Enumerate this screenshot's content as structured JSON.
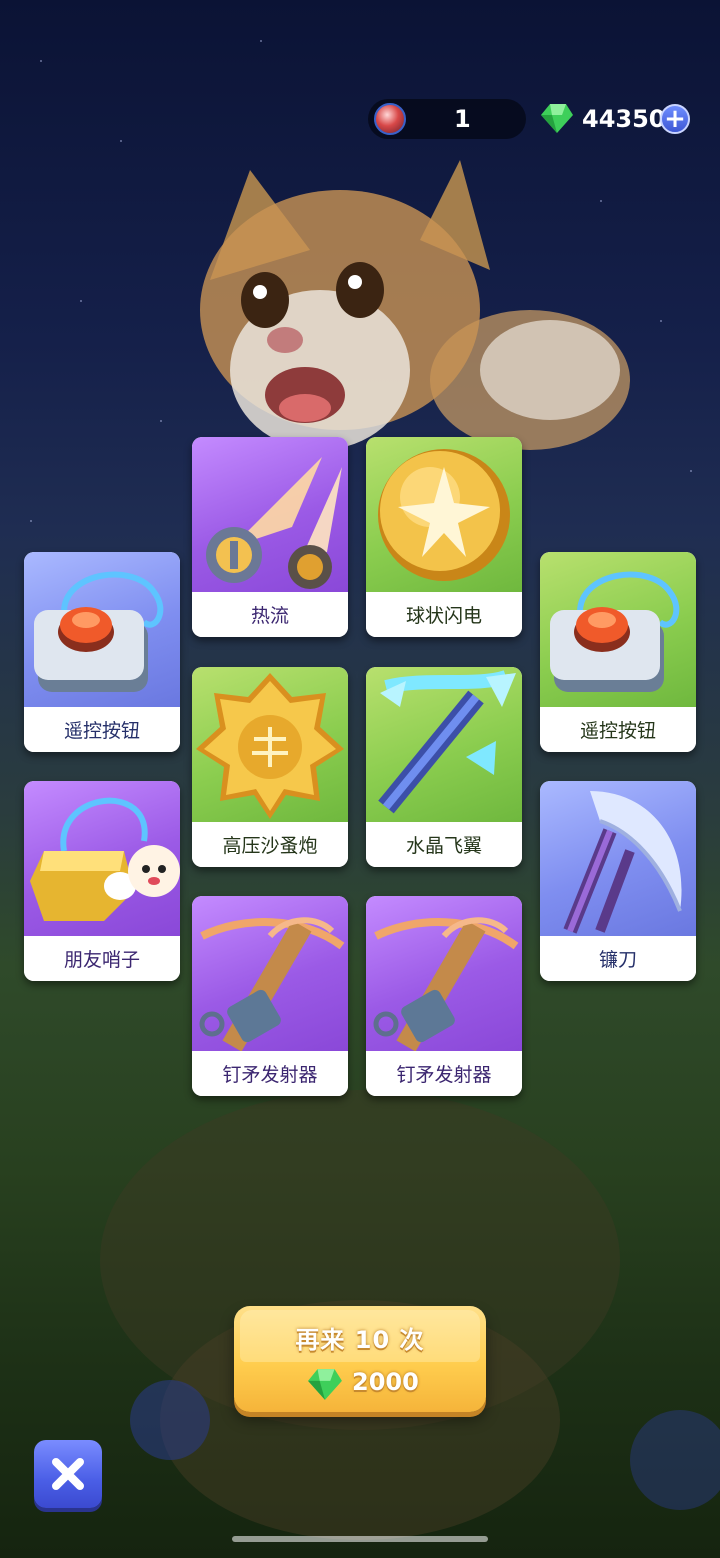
{
  "currency": {
    "tickets": "1",
    "gems": "44350",
    "ticket_icon": "ball-ticket-icon",
    "gem_icon": "green-gem-icon",
    "plus_icon": "plus-icon"
  },
  "character": {
    "name_icon": "corgi-dog-character"
  },
  "cards": [
    {
      "id": "remote-button-left",
      "label": "遥控按钮",
      "rarity": "blue",
      "icon": "remote-button-icon"
    },
    {
      "id": "friend-whistle",
      "label": "朋友哨子",
      "rarity": "purple",
      "icon": "whistle-icon"
    },
    {
      "id": "heat-flow",
      "label": "热流",
      "rarity": "purple",
      "icon": "heat-flow-icon"
    },
    {
      "id": "sandworm-cannon",
      "label": "高压沙蚤炮",
      "rarity": "green",
      "icon": "golden-badge-icon"
    },
    {
      "id": "harpoon-launcher-1",
      "label": "钉矛发射器",
      "rarity": "purple",
      "icon": "crossbow-icon"
    },
    {
      "id": "ball-lightning",
      "label": "球状闪电",
      "rarity": "green",
      "icon": "golden-orb-icon"
    },
    {
      "id": "crystal-wings",
      "label": "水晶飞翼",
      "rarity": "green",
      "icon": "crystal-pickaxe-icon"
    },
    {
      "id": "harpoon-launcher-2",
      "label": "钉矛发射器",
      "rarity": "purple",
      "icon": "crossbow-icon"
    },
    {
      "id": "remote-button-right",
      "label": "遥控按钮",
      "rarity": "green",
      "icon": "remote-button-icon"
    },
    {
      "id": "scythe",
      "label": "镰刀",
      "rarity": "blue",
      "icon": "scythe-icon"
    }
  ],
  "replay": {
    "label": "再来 10 次",
    "cost": "2000",
    "cost_icon": "green-gem-icon"
  },
  "close": {
    "icon": "close-icon"
  },
  "colors": {
    "purple": "#9b5ae6",
    "green": "#8bcd4f",
    "blue": "#7f8ef0",
    "accent": "#ffcd4e"
  }
}
